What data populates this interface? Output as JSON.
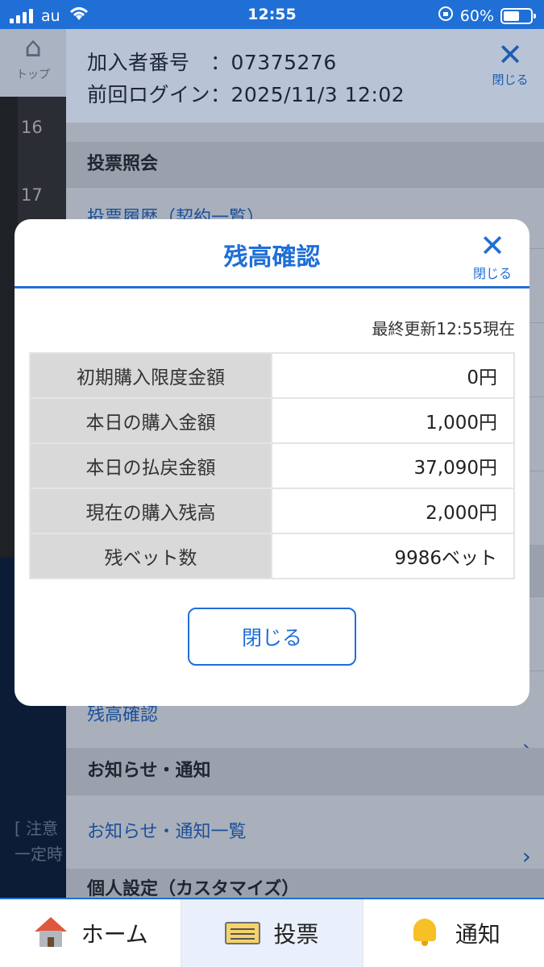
{
  "status_bar": {
    "carrier": "au",
    "time": "12:55",
    "battery_text": "60%",
    "battery_level": 0.6
  },
  "sidebar": {
    "top_label": "トップ",
    "days": [
      "16",
      "17"
    ],
    "notice_line1": "[ 注意",
    "notice_line2": "一定時"
  },
  "header": {
    "member_line": "加入者番号　：07375276",
    "last_login_line": "前回ログイン：2025/11/3 12:02",
    "close_label": "閉じる"
  },
  "menu": {
    "section_vote_inquiry": "投票照会",
    "row_vote_history": "投票履歴（契約一覧）",
    "row_balance_check": "残高確認",
    "section_notifications": "お知らせ・通知",
    "row_notification_list": "お知らせ・通知一覧",
    "section_personal_settings": "個人設定（カスタマイズ）"
  },
  "modal": {
    "title": "残高確認",
    "close_label": "閉じる",
    "updated": "最終更新12:55現在",
    "rows": [
      {
        "label": "初期購入限度金額",
        "value": "0円"
      },
      {
        "label": "本日の購入金額",
        "value": "1,000円"
      },
      {
        "label": "本日の払戻金額",
        "value": "37,090円"
      },
      {
        "label": "現在の購入残高",
        "value": "2,000円"
      },
      {
        "label": "残ベット数",
        "value": "9986ベット"
      }
    ],
    "close_button": "閉じる"
  },
  "tabbar": {
    "tabs": [
      {
        "label": "ホーム"
      },
      {
        "label": "投票"
      },
      {
        "label": "通知"
      }
    ]
  },
  "colors": {
    "accent": "#1f6fd6",
    "status_bar": "#1f6fd6"
  }
}
